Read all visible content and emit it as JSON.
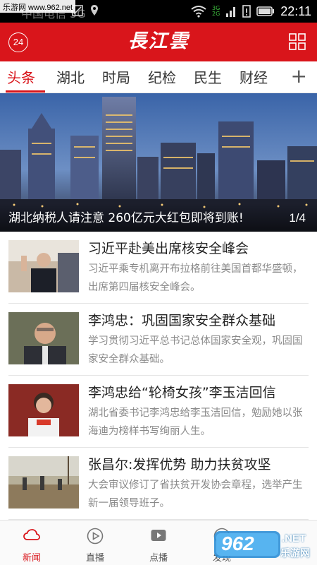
{
  "status_bar": {
    "watermark": "乐游网 www.962.net",
    "carrier_ghost": "中国电信 5G",
    "time": "22:11",
    "net_tags": [
      "3G",
      "2G"
    ]
  },
  "header": {
    "badge": "24",
    "logo": "長江雲"
  },
  "tabs": {
    "items": [
      "头条",
      "湖北",
      "时局",
      "纪检",
      "民生",
      "财经"
    ],
    "active": "头条",
    "add_label": "+"
  },
  "banner": {
    "title": "湖北纳税人请注意 260亿元大红包即将到账!",
    "page_indicator": "1/4",
    "current_page": 1,
    "total_pages": 4
  },
  "news": [
    {
      "title": "习近平赴美出席核安全峰会",
      "summary": "习近平乘专机离开布拉格前往美国首都华盛顿，出席第四届核安全峰会。"
    },
    {
      "title": "李鸿忠：巩固国家安全群众基础",
      "summary": "学习贯彻习近平总书记总体国家安全观，巩固国家安全群众基础。"
    },
    {
      "title": "李鸿忠给“轮椅女孩”李玉洁回信",
      "summary": "湖北省委书记李鸿忠给李玉洁回信，勉励她以张海迪为榜样书写绚丽人生。"
    },
    {
      "title": "张昌尔:发挥优势 助力扶贫攻坚",
      "summary": "大会审议修订了省扶贫开发协会章程，选举产生新一届领导班子。"
    }
  ],
  "bottom_nav": {
    "items": [
      "新闻",
      "直播",
      "点播",
      "发现"
    ],
    "active": "新闻"
  },
  "watermark_bottom": {
    "number": "962",
    "suffix": ".NET",
    "text": "乐游网"
  },
  "colors": {
    "brand_red": "#d9151b",
    "text_dark": "#222222",
    "text_gray": "#8a8a8a"
  }
}
